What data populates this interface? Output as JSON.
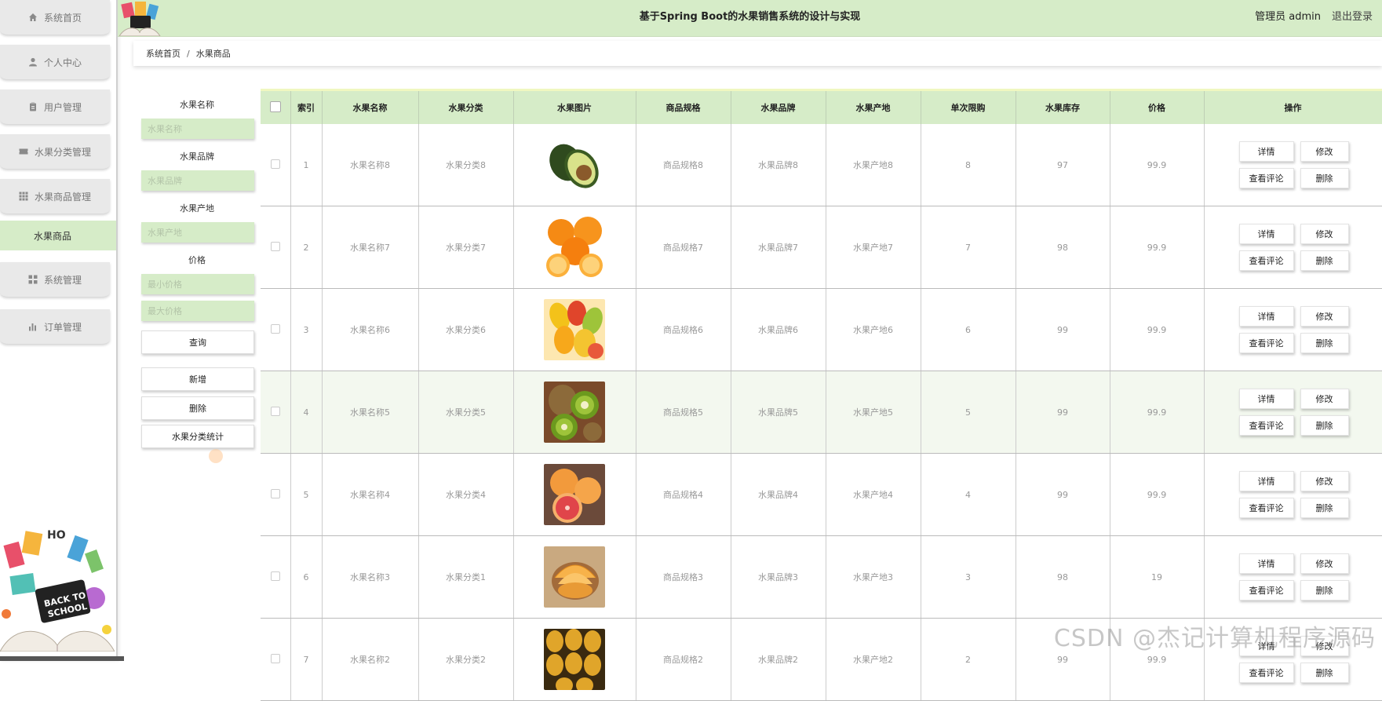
{
  "sidebar": {
    "items": [
      {
        "label": "系统首页",
        "icon": "home-icon"
      },
      {
        "label": "个人中心",
        "icon": "user-icon"
      },
      {
        "label": "用户管理",
        "icon": "clipboard-icon"
      },
      {
        "label": "水果分类管理",
        "icon": "ticket-icon"
      },
      {
        "label": "水果商品管理",
        "icon": "grid-icon"
      },
      {
        "label": "系统管理",
        "icon": "apps-icon"
      },
      {
        "label": "订单管理",
        "icon": "bar-chart-icon"
      }
    ],
    "active_item": "水果商品",
    "art_text": {
      "line1": "BACK TO",
      "line2": "SCHOOL",
      "letters": "HO"
    }
  },
  "header": {
    "title": "基于Spring Boot的水果销售系统的设计与实现",
    "admin_label": "管理员 admin",
    "logout_label": "退出登录",
    "accent": "#d6ecc8"
  },
  "breadcrumb": {
    "home": "系统首页",
    "separator": "/",
    "current": "水果商品"
  },
  "filters": {
    "name_label": "水果名称",
    "name_placeholder": "水果名称",
    "brand_label": "水果品牌",
    "brand_placeholder": "水果品牌",
    "origin_label": "水果产地",
    "origin_placeholder": "水果产地",
    "price_label": "价格",
    "min_price_placeholder": "最小价格",
    "max_price_placeholder": "最大价格",
    "search_button": "查询",
    "add_button": "新增",
    "delete_button": "删除",
    "stats_button": "水果分类统计"
  },
  "table": {
    "headers": [
      "索引",
      "水果名称",
      "水果分类",
      "水果图片",
      "商品规格",
      "水果品牌",
      "水果产地",
      "单次限购",
      "水果库存",
      "价格",
      "操作"
    ],
    "row_actions": {
      "detail": "详情",
      "edit": "修改",
      "comments": "查看评论",
      "delete": "删除"
    },
    "rows": [
      {
        "index": "1",
        "name": "水果名称8",
        "category": "水果分类8",
        "image": "avocado",
        "spec": "商品规格8",
        "brand": "水果品牌8",
        "origin": "水果产地8",
        "limit": "8",
        "stock": "97",
        "price": "99.9"
      },
      {
        "index": "2",
        "name": "水果名称7",
        "category": "水果分类7",
        "image": "orange",
        "spec": "商品规格7",
        "brand": "水果品牌7",
        "origin": "水果产地7",
        "limit": "7",
        "stock": "98",
        "price": "99.9"
      },
      {
        "index": "3",
        "name": "水果名称6",
        "category": "水果分类6",
        "image": "mango",
        "spec": "商品规格6",
        "brand": "水果品牌6",
        "origin": "水果产地6",
        "limit": "6",
        "stock": "99",
        "price": "99.9"
      },
      {
        "index": "4",
        "name": "水果名称5",
        "category": "水果分类5",
        "image": "kiwi",
        "spec": "商品规格5",
        "brand": "水果品牌5",
        "origin": "水果产地5",
        "limit": "5",
        "stock": "99",
        "price": "99.9"
      },
      {
        "index": "5",
        "name": "水果名称4",
        "category": "水果分类4",
        "image": "grapefruit",
        "spec": "商品规格4",
        "brand": "水果品牌4",
        "origin": "水果产地4",
        "limit": "4",
        "stock": "99",
        "price": "99.9"
      },
      {
        "index": "6",
        "name": "水果名称3",
        "category": "水果分类1",
        "image": "melon",
        "spec": "商品规格3",
        "brand": "水果品牌3",
        "origin": "水果产地3",
        "limit": "3",
        "stock": "98",
        "price": "19"
      },
      {
        "index": "7",
        "name": "水果名称2",
        "category": "水果分类2",
        "image": "pineapple",
        "spec": "商品规格2",
        "brand": "水果品牌2",
        "origin": "水果产地2",
        "limit": "2",
        "stock": "99",
        "price": "99.9"
      }
    ]
  },
  "watermark": "CSDN @杰记计算机程序源码"
}
